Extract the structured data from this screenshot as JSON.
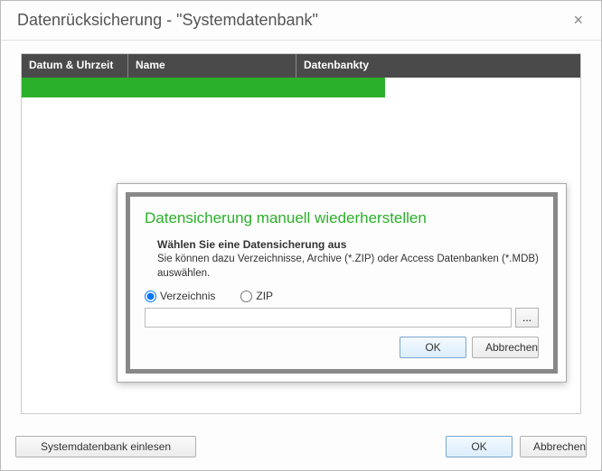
{
  "window": {
    "title": "Datenrücksicherung - \"Systemdatenbank\""
  },
  "table": {
    "columns": {
      "c1": "Datum & Uhrzeit",
      "c2": "Name",
      "c3": "Datenbankty"
    }
  },
  "footer": {
    "readin_label": "Systemdatenbank einlesen",
    "ok_label": "OK",
    "cancel_label": "Abbrechen"
  },
  "inner": {
    "heading": "Datensicherung manuell wiederherstellen",
    "instr_title": "Wählen Sie eine Datensicherung aus",
    "instr_body": "Sie können dazu Verzeichnisse, Archive (*.ZIP) oder Access Datenbanken (*.MDB) auswählen.",
    "radio_dir": "Verzeichnis",
    "radio_zip": "ZIP",
    "path_value": "",
    "browse_label": "...",
    "ok_label": "OK",
    "cancel_label": "Abbrechen"
  }
}
